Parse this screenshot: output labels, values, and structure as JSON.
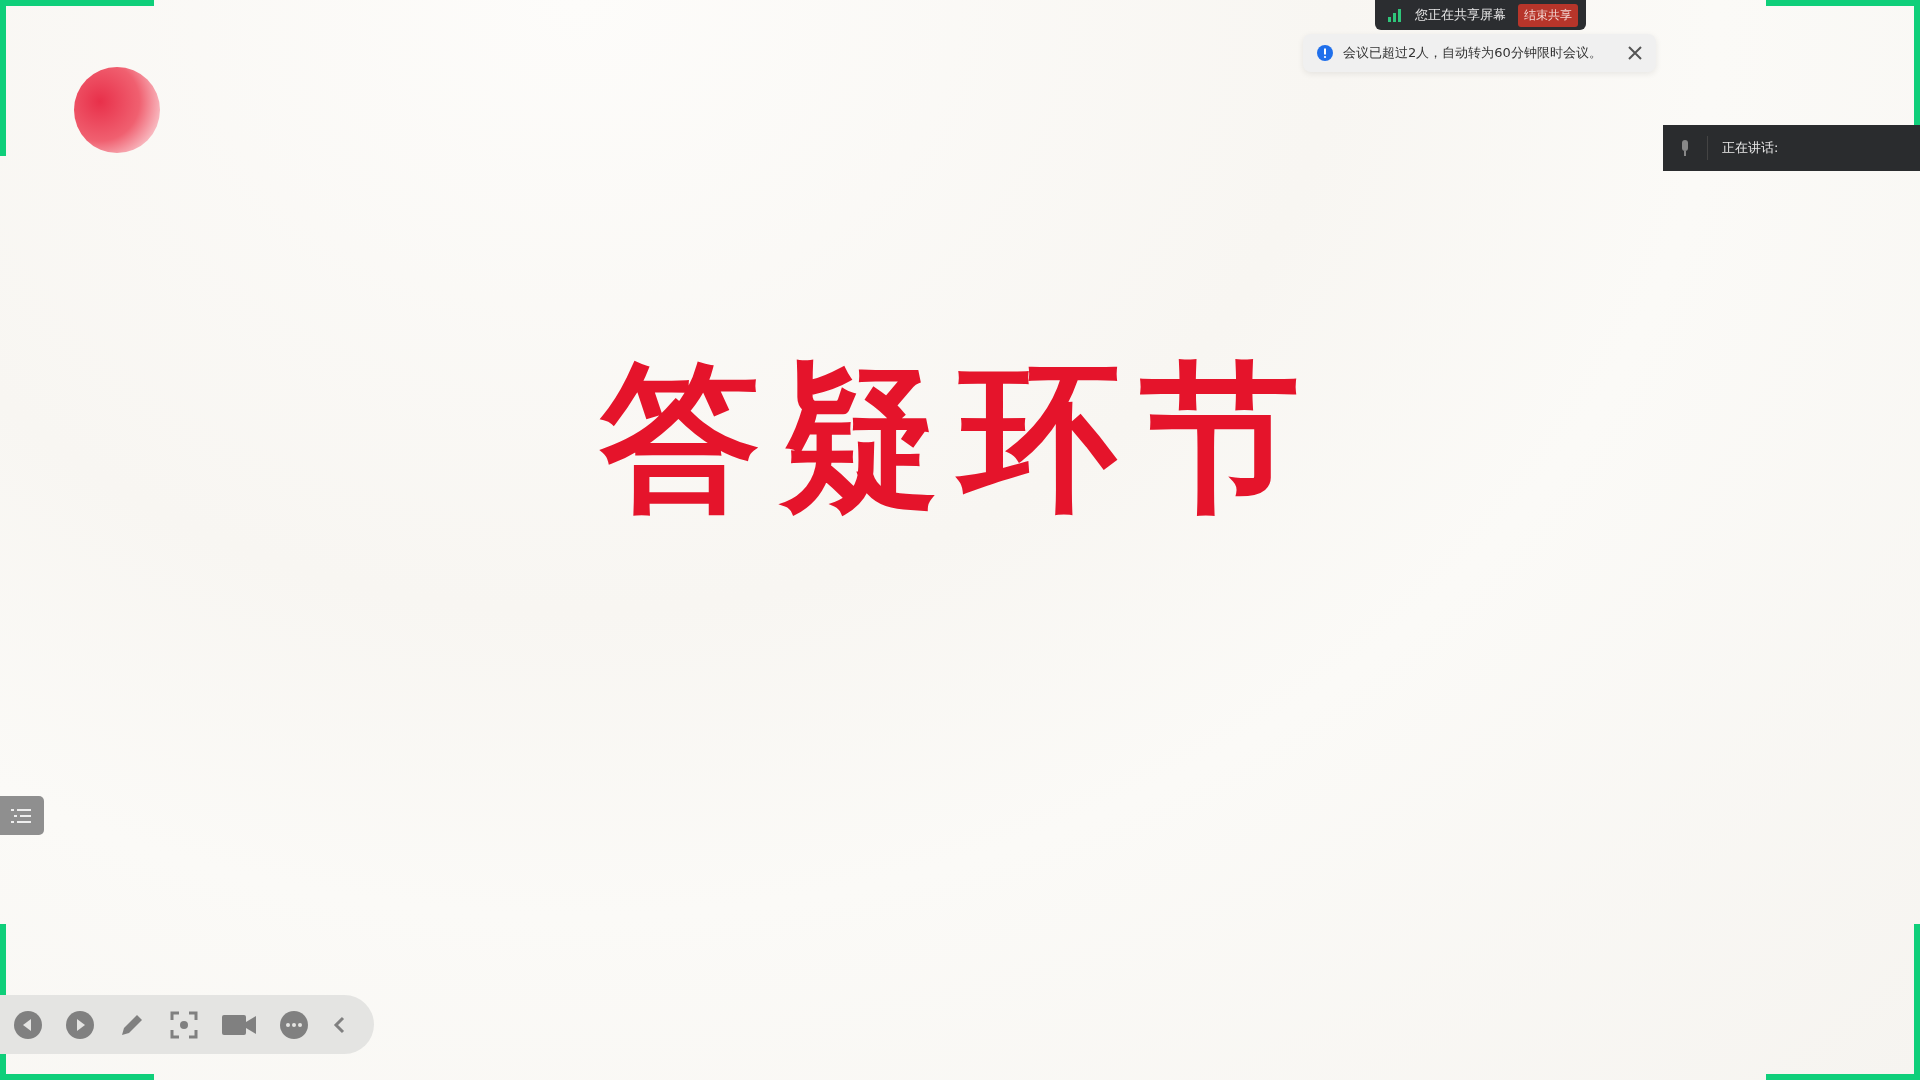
{
  "sharing_bar": {
    "status": "您正在共享屏幕",
    "stop_button": "结束共享"
  },
  "notice": {
    "message": "会议已超过2人，自动转为60分钟限时会议。"
  },
  "speaker_panel": {
    "label": "正在讲话:"
  },
  "slide": {
    "title": "答疑环节"
  }
}
